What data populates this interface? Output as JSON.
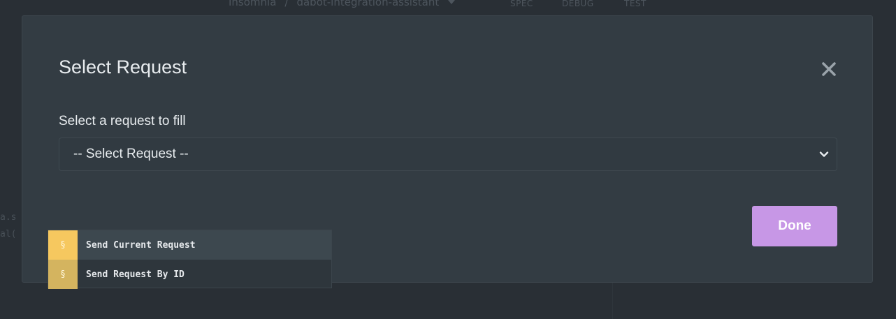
{
  "background": {
    "breadcrumb": {
      "app": "Insomnia",
      "separator": "/",
      "project": "dabot-integration-assistant"
    },
    "tabs": [
      "SPEC",
      "DEBUG",
      "TEST"
    ],
    "code_lines": [
      "a.s",
      "al("
    ]
  },
  "modal": {
    "title": "Select Request",
    "field_label": "Select a request to fill",
    "select": {
      "selected": "-- Select Request --"
    },
    "done_label": "Done"
  },
  "autocomplete": {
    "items": [
      {
        "icon": "§",
        "label": "Send Current Request"
      },
      {
        "icon": "§",
        "label": "Send Request By ID"
      }
    ]
  },
  "colors": {
    "accent": "#c797e6",
    "tag_yellow": "#f6c85f",
    "modal_bg": "#333c43"
  }
}
